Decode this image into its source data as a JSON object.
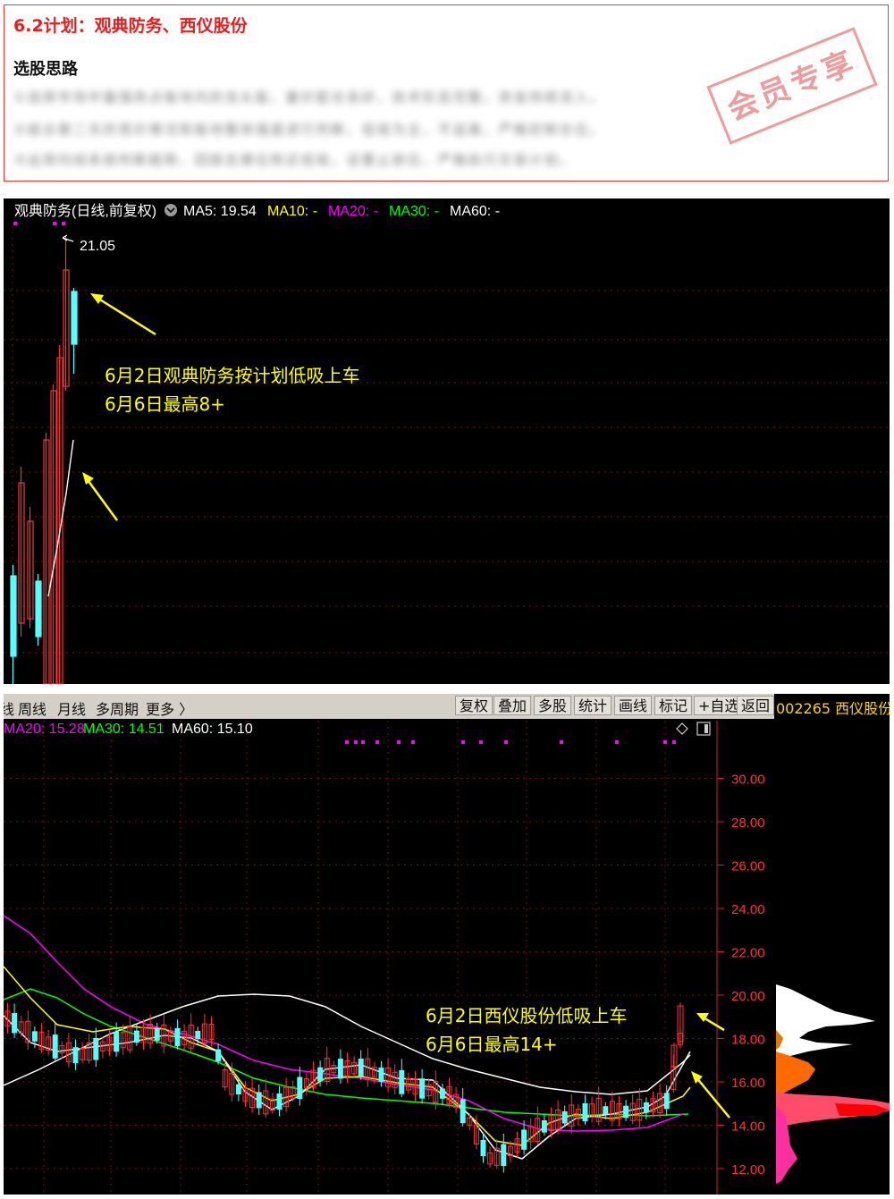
{
  "plan": {
    "title": "6.2计划：观典防务、西仪股份",
    "subtitle": "选股思路",
    "blurred_lines": [
      "①选择市场中最强热点板块内的龙头股，量价配合良好，技术形态完整，资金持续流入。",
      "②结合第二天的竞价情况和板块整体强度进行判断，低吸为主，不追高，严格控制仓位。",
      "③运用均线系统判断趋势，回踩支撑位附近低吸，设置止损位，严格执行交易计划。"
    ],
    "stamp": "会员专享"
  },
  "chart1": {
    "title": "观典防务(日线,前复权)",
    "ma_labels": [
      {
        "text": "MA5: 19.54",
        "color": "#ffffff"
      },
      {
        "text": "MA10: -",
        "color": "#ffff00"
      },
      {
        "text": "MA20: -",
        "color": "#ff00ff"
      },
      {
        "text": "MA30: -",
        "color": "#00ff00"
      },
      {
        "text": "MA60: -",
        "color": "#ffffff"
      }
    ],
    "peak_label": "21.05",
    "annotation_1": "6月2日观典防务按计划低吸上车",
    "annotation_2": "6月6日最高8+"
  },
  "chart2": {
    "toolbar_left": [
      "线",
      "周线",
      "月线",
      "多周期",
      "更多 〉"
    ],
    "toolbar_right": [
      "复权",
      "叠加",
      "多股",
      "统计",
      "画线",
      "标记",
      "+自选",
      "返回"
    ],
    "stock": "002265 西仪股份",
    "ma_labels": [
      {
        "text": "MA20: 15.28",
        "color": "#ff00ff"
      },
      {
        "text": "MA30: 14.51",
        "color": "#00ff00"
      },
      {
        "text": "MA60: 15.10",
        "color": "#ffffff"
      }
    ],
    "price_ticks": [
      "30.00",
      "28.00",
      "26.00",
      "24.00",
      "22.00",
      "20.00",
      "18.00",
      "16.00",
      "14.00",
      "12.00"
    ],
    "annotation_1": "6月2日西仪股份低吸上车",
    "annotation_2": "6月6日最高14+"
  },
  "colors": {
    "up": "#ff3232",
    "down": "#54ffff",
    "accent_red": "#e81e1e",
    "anno": "#ffff00"
  }
}
